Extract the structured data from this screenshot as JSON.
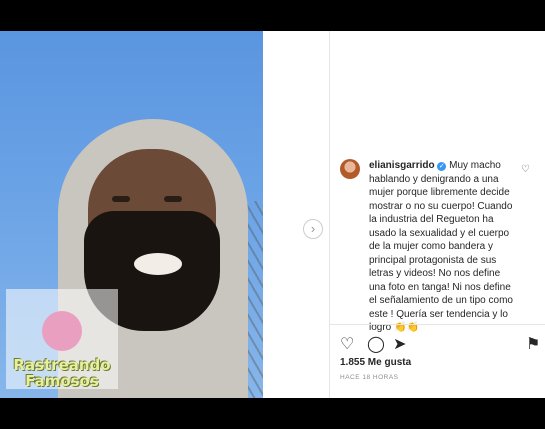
{
  "caption": {
    "username": "elianisgarrido",
    "verified_badge": "✓",
    "text": "Muy macho hablando y denigrando a una mujer porque libremente decide mostrar o no su cuerpo! Cuando la industria del Regueton ha usado la sexualidad y el cuerpo de la mujer como bandera y principal protagonista de sus letras y videos! No nos define una foto en tanga! Ni nos define el señalamiento de un tipo como este ! Quería ser tendencia y lo logro 👏👏"
  },
  "watermark": {
    "line1": "Rastreando",
    "line2": "Famosos"
  },
  "post": {
    "likes": "1.855 Me gusta",
    "time": "HACE 18 HORAS"
  },
  "icons": {
    "next": "›",
    "heart_small": "♡",
    "like": "♡",
    "comment": "◯",
    "share": "➤",
    "save": "⚑"
  }
}
